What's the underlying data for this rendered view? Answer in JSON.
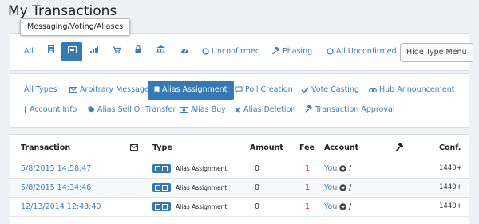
{
  "page": {
    "title": "My Transactions"
  },
  "tooltip": {
    "text": "Messaging/Voting/Aliases"
  },
  "type_menu": [
    {
      "label": "All",
      "icon": ""
    },
    {
      "label": "",
      "icon": "calculator-icon"
    },
    {
      "label": "",
      "icon": "message-box-icon"
    },
    {
      "label": "",
      "icon": "signal-bars-icon"
    },
    {
      "label": "",
      "icon": "shopping-cart-icon"
    },
    {
      "label": "",
      "icon": "lock-icon"
    },
    {
      "label": "",
      "icon": "bank-icon"
    },
    {
      "label": "",
      "icon": "dashboard-icon"
    },
    {
      "label": "Unconfirmed",
      "icon": "circle-icon"
    },
    {
      "label": "Phasing",
      "icon": "gavel-icon"
    },
    {
      "label": "All Unconfirmed",
      "icon": "circle-icon"
    }
  ],
  "hide_menu_label": "Hide Type Menu",
  "subtypes": [
    {
      "label": "All Types",
      "icon": ""
    },
    {
      "label": "Arbitrary Message",
      "icon": "envelope-icon"
    },
    {
      "label": "Alias Assignment",
      "icon": "bookmark-icon"
    },
    {
      "label": "Poll Creation",
      "icon": "chat-icon"
    },
    {
      "label": "Vote Casting",
      "icon": "check-icon"
    },
    {
      "label": "Hub Announcement",
      "icon": "link-icon"
    },
    {
      "label": "Account Info",
      "icon": "info-icon"
    },
    {
      "label": "Alias Sell Or Transfer",
      "icon": "tag-icon"
    },
    {
      "label": "Alias Buy",
      "icon": "money-icon"
    },
    {
      "label": "Alias Deletion",
      "icon": "x-icon"
    },
    {
      "label": "Transaction Approval",
      "icon": "gavel-icon"
    }
  ],
  "table": {
    "headers": {
      "transaction": "Transaction",
      "type": "Type",
      "amount": "Amount",
      "fee": "Fee",
      "account": "Account",
      "confirmations": "Conf."
    },
    "rows": [
      {
        "transaction": "5/8/2015 14:58:47",
        "type": "Alias Assignment",
        "amount": "0",
        "fee": "1",
        "account": "You",
        "account_suffix": "/",
        "confirmations": "1440+"
      },
      {
        "transaction": "5/8/2015 14:34:46",
        "type": "Alias Assignment",
        "amount": "0",
        "fee": "1",
        "account": "You",
        "account_suffix": "/",
        "confirmations": "1440+"
      },
      {
        "transaction": "12/13/2014 12:43:40",
        "type": "Alias Assignment",
        "amount": "0",
        "fee": "1",
        "account": "You",
        "account_suffix": "/",
        "confirmations": "1440+"
      }
    ]
  },
  "colors": {
    "accent": "#337ab7",
    "link": "#3a7fc1",
    "fee": "#d9232e",
    "background": "#eef1f4"
  }
}
